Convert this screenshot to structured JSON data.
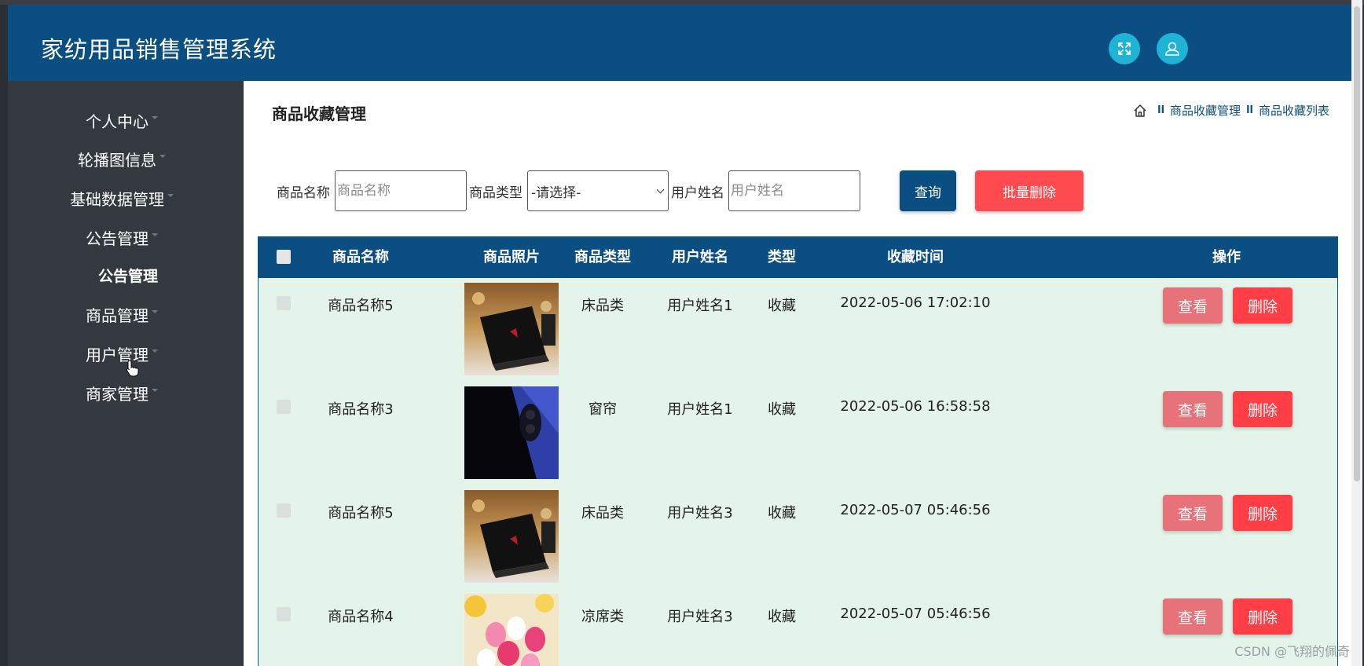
{
  "app": {
    "title": "家纺用品销售管理系统"
  },
  "sidebar": {
    "items": [
      {
        "label": "个人中心"
      },
      {
        "label": "轮播图信息"
      },
      {
        "label": "基础数据管理"
      },
      {
        "label": "公告管理"
      },
      {
        "label": "公告管理"
      },
      {
        "label": "商品管理"
      },
      {
        "label": "用户管理"
      },
      {
        "label": "商家管理"
      }
    ]
  },
  "page": {
    "title": "商品收藏管理",
    "breadcrumb": [
      "商品收藏管理",
      "商品收藏列表"
    ]
  },
  "search": {
    "name_label": "商品名称",
    "name_placeholder": "商品名称",
    "type_label": "商品类型",
    "type_selected": "-请选择-",
    "user_label": "用户姓名",
    "user_placeholder": "用户姓名",
    "query_label": "查询",
    "batch_delete_label": "批量删除"
  },
  "table": {
    "headers": [
      "商品名称",
      "商品照片",
      "商品类型",
      "用户姓名",
      "类型",
      "收藏时间",
      "操作"
    ],
    "rows": [
      {
        "name": "商品名称5",
        "photo": "laptop-photo",
        "category": "床品类",
        "user": "用户姓名1",
        "type": "收藏",
        "time": "2022-05-06 17:02:10"
      },
      {
        "name": "商品名称3",
        "photo": "phone-photo",
        "category": "窗帘",
        "user": "用户姓名1",
        "type": "收藏",
        "time": "2022-05-06 16:58:58"
      },
      {
        "name": "商品名称5",
        "photo": "laptop-photo",
        "category": "床品类",
        "user": "用户姓名3",
        "type": "收藏",
        "time": "2022-05-07 05:46:56"
      },
      {
        "name": "商品名称4",
        "photo": "flowers-photo",
        "category": "凉席类",
        "user": "用户姓名3",
        "type": "收藏",
        "time": "2022-05-07 05:46:56"
      }
    ],
    "view_label": "查看",
    "delete_label": "删除"
  },
  "watermark": "CSDN @飞翔的佩奇",
  "colors": {
    "header": "#0b4f82",
    "sidebar": "#33393f",
    "danger": "#ff3e45",
    "view": "#e7727a",
    "row_bg": "#e4f4ea"
  }
}
